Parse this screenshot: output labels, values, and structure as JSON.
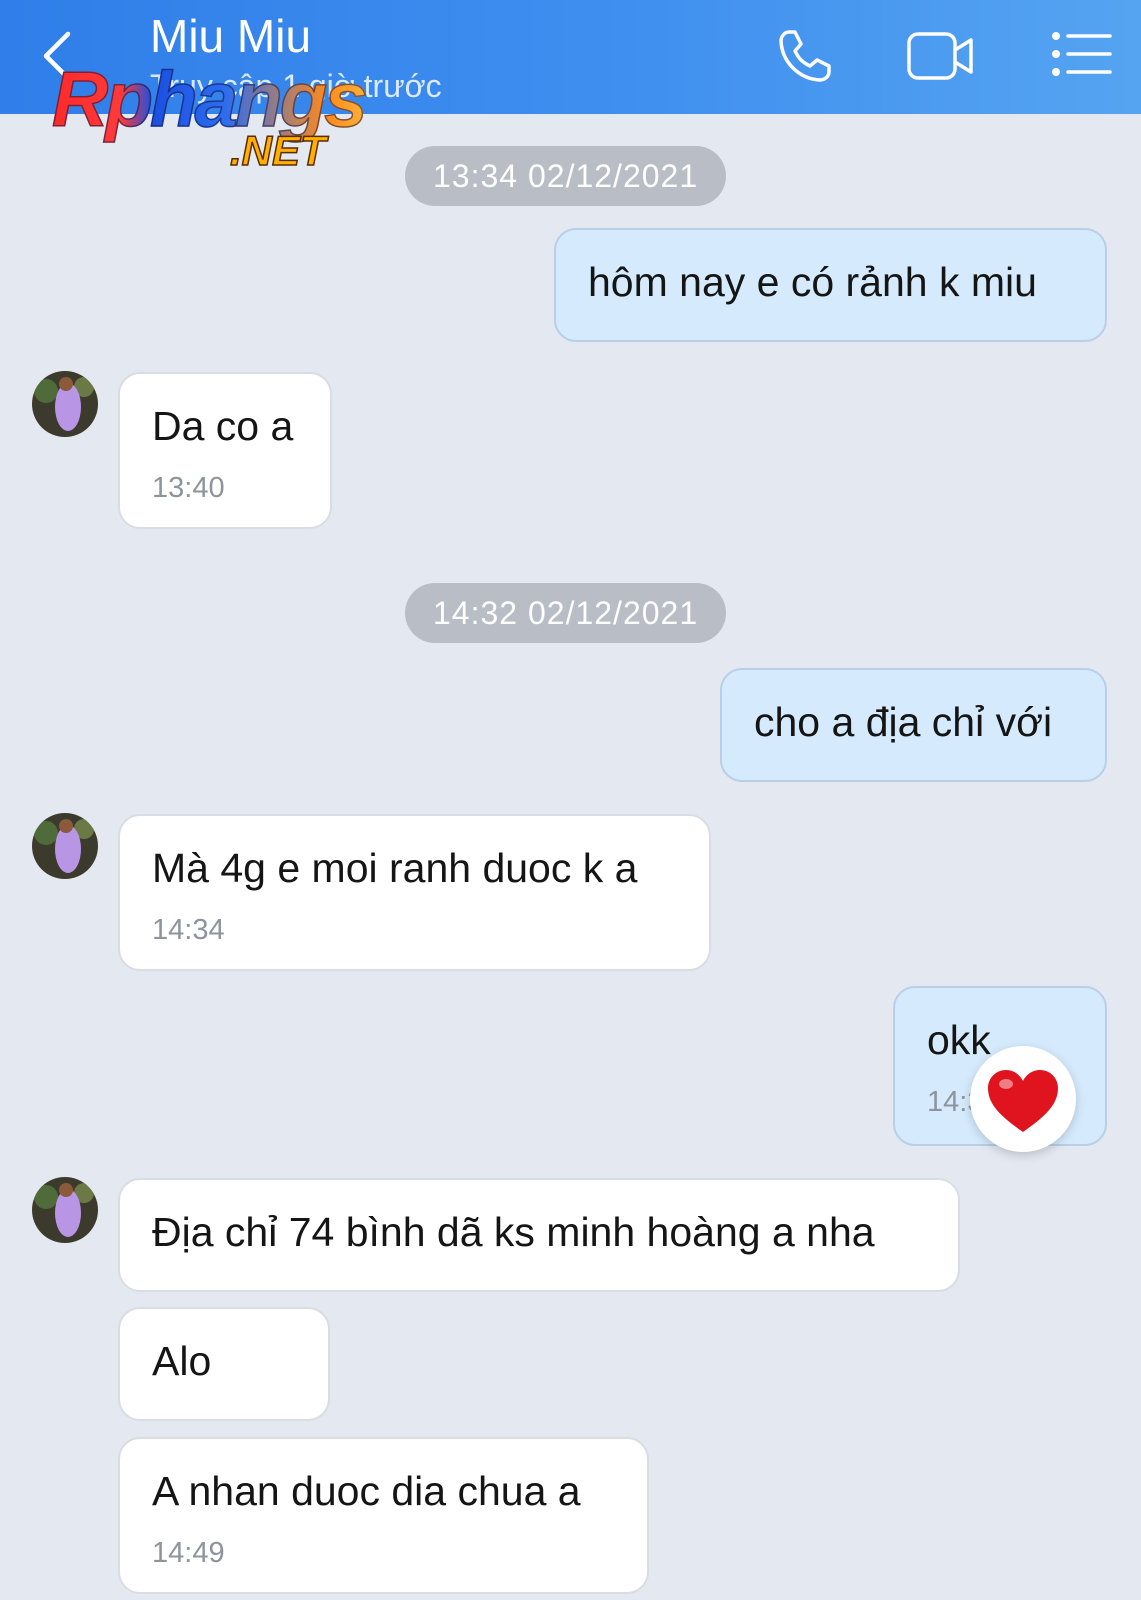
{
  "header": {
    "contact_name": "Miu Miu",
    "status": "Truy cập 1 giờ trước",
    "back_icon": "chevron-left-icon",
    "call_icon": "phone-icon",
    "video_icon": "video-camera-icon",
    "menu_icon": "list-menu-icon",
    "background": "#3f8ff0"
  },
  "watermark": {
    "main": "Rphangs",
    "sub": ".NET"
  },
  "timestamps": [
    "13:34 02/12/2021",
    "14:32 02/12/2021"
  ],
  "messages": [
    {
      "side": "outgoing",
      "text": "hôm nay e có rảnh k miu"
    },
    {
      "side": "incoming",
      "text": "Da co a",
      "time": "13:40"
    },
    {
      "side": "outgoing",
      "text": "cho a địa chỉ với"
    },
    {
      "side": "incoming",
      "text": "Mà 4g e moi ranh duoc k a",
      "time": "14:34"
    },
    {
      "side": "outgoing",
      "text": "okk",
      "time": "14:3",
      "reaction": "heart-icon"
    },
    {
      "side": "incoming",
      "text": "Địa chỉ 74 bình dã ks minh hoàng a nha"
    },
    {
      "side": "incoming",
      "text": "Alo"
    },
    {
      "side": "incoming",
      "text": "A nhan duoc dia chua a",
      "time": "14:49"
    }
  ],
  "colors": {
    "outgoing_bubble": "#d5ebfd",
    "incoming_bubble": "#ffffff",
    "chat_background": "#e3e8f1",
    "time_pill": "#b9bec6",
    "reaction_heart": "#e0141e"
  }
}
